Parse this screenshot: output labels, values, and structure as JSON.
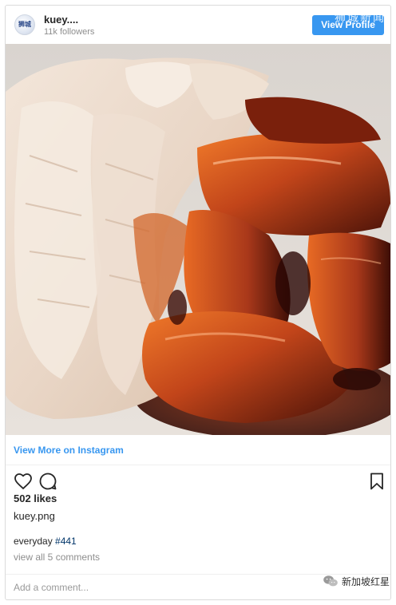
{
  "header": {
    "avatar_text": "狮城",
    "username": "kuey....",
    "followers": "11k followers",
    "view_profile_label": "View Profile",
    "watermark": "狮城新闻"
  },
  "post": {
    "image_subject": "sliced white chicken and char siu roast pork with dark sauce",
    "view_more_label": "View More on Instagram",
    "likes": "502 likes",
    "filename": "kuey.png",
    "caption_text": "everyday ",
    "caption_hashtag": "#441",
    "comments_link": "view all 5 comments",
    "comment_placeholder": "Add a comment...",
    "bottom_watermark": "新加坡红星"
  },
  "icons": {
    "like": "heart-icon",
    "comment": "comment-bubble-icon",
    "save": "bookmark-icon",
    "watermark_logo": "wechat-icon"
  },
  "colors": {
    "accent": "#3897f0",
    "text": "#262626",
    "muted": "#8e8e8e",
    "border": "#dbdbdb"
  }
}
